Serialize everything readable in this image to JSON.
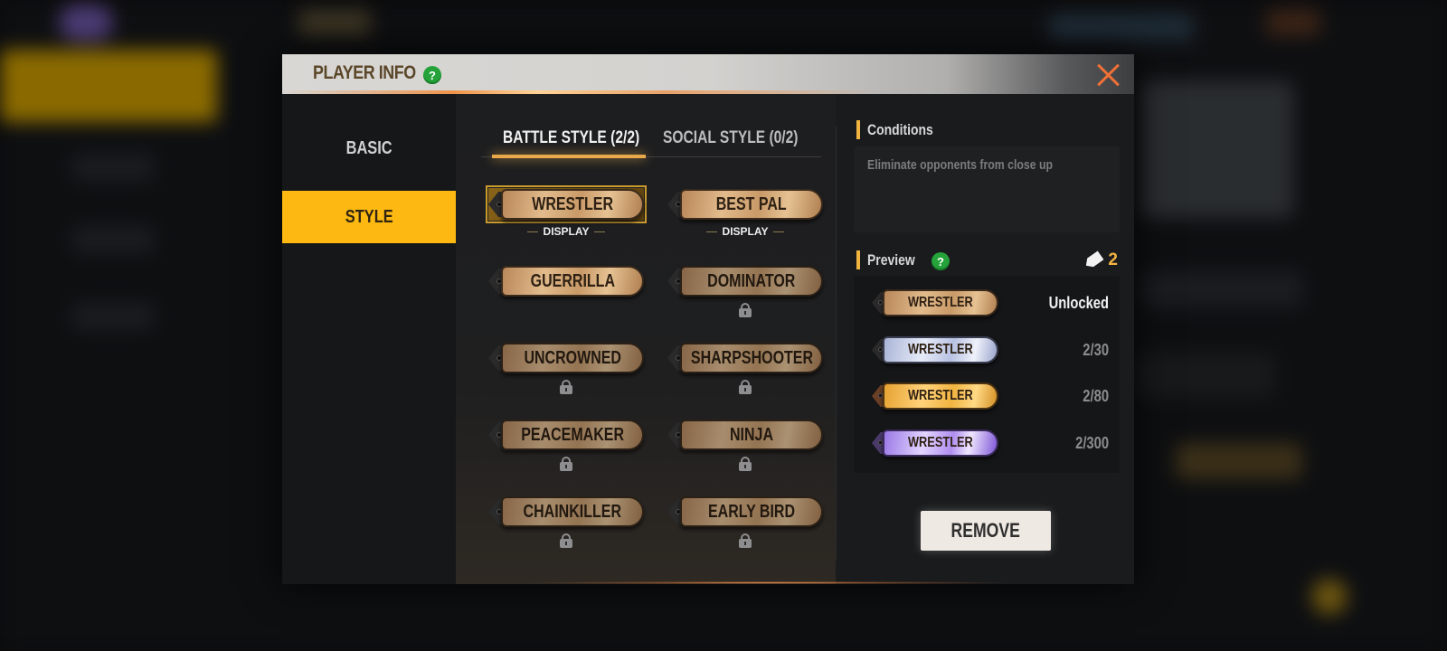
{
  "dialog": {
    "title": "PLAYER INFO",
    "help_icon": "?",
    "close_icon": "close-x"
  },
  "nav": {
    "items": [
      {
        "label": "BASIC",
        "active": false
      },
      {
        "label": "STYLE",
        "active": true
      }
    ]
  },
  "tabs": [
    {
      "label": "BATTLE STYLE (2/2)",
      "active": true
    },
    {
      "label": "SOCIAL STYLE (0/2)",
      "active": false
    }
  ],
  "styles": [
    {
      "label": "WRESTLER",
      "status": "DISPLAY",
      "locked": false,
      "selected": true
    },
    {
      "label": "BEST PAL",
      "status": "DISPLAY",
      "locked": false,
      "selected": false
    },
    {
      "label": "GUERRILLA",
      "status": "",
      "locked": false,
      "selected": false
    },
    {
      "label": "DOMINATOR",
      "status": "",
      "locked": true,
      "selected": false
    },
    {
      "label": "UNCROWNED",
      "status": "",
      "locked": true,
      "selected": false
    },
    {
      "label": "SHARPSHOOTER",
      "status": "",
      "locked": true,
      "selected": false
    },
    {
      "label": "PEACEMAKER",
      "status": "",
      "locked": true,
      "selected": false
    },
    {
      "label": "NINJA",
      "status": "",
      "locked": true,
      "selected": false
    },
    {
      "label": "CHAINKILLER",
      "status": "",
      "locked": true,
      "selected": false
    },
    {
      "label": "EARLY BIRD",
      "status": "",
      "locked": true,
      "selected": false
    }
  ],
  "conditions": {
    "title": "Conditions",
    "text": "Eliminate opponents from close up"
  },
  "preview": {
    "title": "Preview",
    "help_icon": "?",
    "tag_count": "2",
    "rows": [
      {
        "label": "WRESTLER",
        "tier": "gold",
        "value": "Unlocked"
      },
      {
        "label": "WRESTLER",
        "tier": "silver",
        "value": "2/30"
      },
      {
        "label": "WRESTLER",
        "tier": "amber",
        "value": "2/80"
      },
      {
        "label": "WRESTLER",
        "tier": "violet",
        "value": "2/300"
      }
    ]
  },
  "actions": {
    "remove_label": "REMOVE"
  },
  "colors": {
    "accent": "#fdb811",
    "close": "#f07036",
    "help": "#25a33a",
    "section_bar": "#f2b441"
  }
}
